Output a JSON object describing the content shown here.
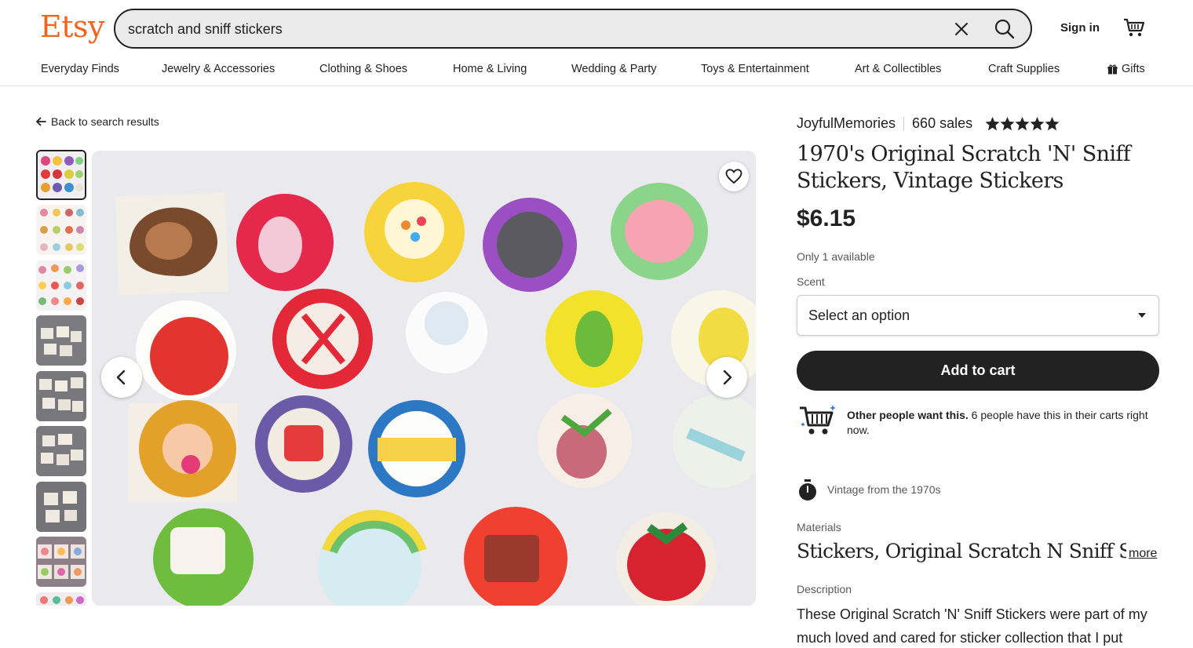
{
  "header": {
    "logo": "Etsy",
    "search_value": "scratch and sniff stickers",
    "sign_in": "Sign in"
  },
  "nav": [
    "Everyday Finds",
    "Jewelry & Accessories",
    "Clothing & Shoes",
    "Home & Living",
    "Wedding & Party",
    "Toys & Entertainment",
    "Art & Collectibles",
    "Craft Supplies",
    "Gifts"
  ],
  "gallery": {
    "back_label": "Back to search results"
  },
  "listing": {
    "shop_name": "JoyfulMemories",
    "sales": "660 sales",
    "rating": 5,
    "title": "1970's Original Scratch 'N' Sniff Stickers, Vintage Stickers",
    "price": "$6.15",
    "availability": "Only 1 available",
    "scent_label": "Scent",
    "scent_placeholder": "Select an option",
    "add_to_cart": "Add to cart",
    "demand_bold": "Other people want this.",
    "demand_text": " 6 people have this in their carts right now.",
    "vintage": "Vintage from the 1970s",
    "materials_label": "Materials",
    "materials": "Stickers, Original Scratch N Sniff S...",
    "more": "more",
    "description_label": "Description",
    "description": "These Original Scratch 'N' Sniff Stickers were part of my much loved and cared for sticker collection that I put"
  },
  "colors": {
    "brand": "#f1641e",
    "button": "#222222"
  }
}
